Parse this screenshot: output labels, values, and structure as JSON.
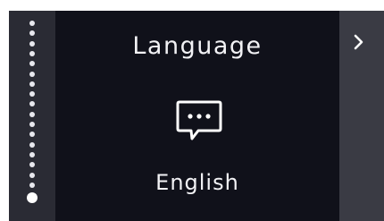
{
  "screen": {
    "title": "Language",
    "value": "English"
  },
  "pagination": {
    "total": 18,
    "current": 18
  },
  "icons": {
    "language": "speech-bubble-ellipsis-icon",
    "next": "chevron-right-icon"
  },
  "colors": {
    "background": "#10111a",
    "rail": "#2a2b34",
    "next_panel": "#3a3b44",
    "text": "#f2f2f5"
  }
}
